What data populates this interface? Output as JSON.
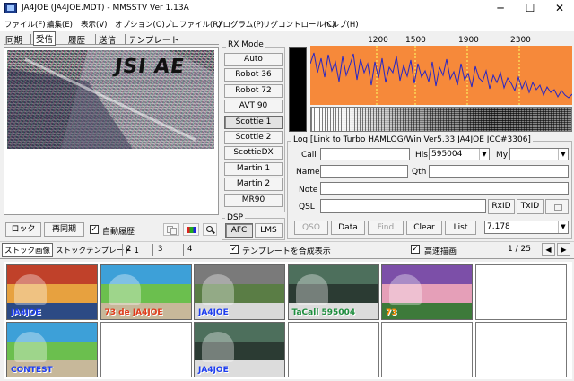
{
  "window": {
    "title": "JA4JOE (JA4JOE.MDT) - MMSSTV Ver 1.13A",
    "minimize": "─",
    "maximize": "☐",
    "close": "✕"
  },
  "menu": [
    "ファイル(F)",
    "編集(E)",
    "表示(V)",
    "オプション(O)",
    "プロファイル(R)",
    "プログラム(P)",
    "リグコントロール(C)",
    "ヘルプ(H)"
  ],
  "tabs": [
    "同期",
    "受信",
    "履歴",
    "送信",
    "テンプレート"
  ],
  "active_tab": "受信",
  "rx_image": {
    "overlay_text": "JSI AE"
  },
  "rx_mode": {
    "label": "RX Mode",
    "modes": [
      "Auto",
      "Robot 36",
      "Robot 72",
      "AVT 90",
      "Scottie 1",
      "Scottie 2",
      "ScottieDX",
      "Martin 1",
      "Martin 2",
      "MR90"
    ],
    "selected": "Scottie 1"
  },
  "dsp": {
    "label": "DSP",
    "afc": "AFC",
    "lms": "LMS"
  },
  "spectrum": {
    "freq_labels": [
      "1200",
      "1500",
      "1900",
      "2300"
    ],
    "colors": {
      "background": "#f6893a",
      "trace": "#2626c6",
      "marker_1200": "#ffff66",
      "marker_1500": "#ffff66",
      "marker_1900": "#ffff66",
      "marker_2300": "#ffff66"
    }
  },
  "log": {
    "title": "Log [Link to Turbo HAMLOG/Win Ver5.33  JA4JOE JCC#3306]",
    "call_label": "Call",
    "name_label": "Name",
    "note_label": "Note",
    "qsl_label": "QSL",
    "his_label": "His",
    "his_value": "595004",
    "my_label": "My",
    "qth_label": "Qth",
    "rxid": "RxID",
    "txid": "TxID",
    "buttons": [
      "QSO",
      "Data",
      "Find",
      "Clear",
      "List"
    ],
    "freq_value": "7.178"
  },
  "controls": {
    "lock": "ロック",
    "resync": "再同期",
    "auto_history": "自動履歴"
  },
  "stock_bar": {
    "tabs": [
      "ストック画像",
      "ストックテンプレート 1",
      "2",
      "3",
      "4"
    ],
    "active": "ストック画像",
    "composite": "テンプレートを合成表示",
    "fast_draw": "高速描画",
    "page": "1 / 25",
    "prev": "◀",
    "next": "▶"
  },
  "thumbnails": [
    {
      "kind": "image",
      "caption": "JA4JOE"
    },
    {
      "kind": "image",
      "caption": "73 de JA4JOE"
    },
    {
      "kind": "image",
      "caption": "JA4JOE"
    },
    {
      "kind": "image",
      "caption": "TaCall 595004"
    },
    {
      "kind": "image",
      "caption": "73"
    },
    {
      "kind": "empty",
      "caption": ""
    },
    {
      "kind": "image",
      "caption": "CONTEST"
    },
    {
      "kind": "empty",
      "caption": ""
    },
    {
      "kind": "image",
      "caption": "JA4JOE"
    },
    {
      "kind": "empty",
      "caption": ""
    },
    {
      "kind": "empty",
      "caption": ""
    },
    {
      "kind": "empty",
      "caption": ""
    }
  ]
}
